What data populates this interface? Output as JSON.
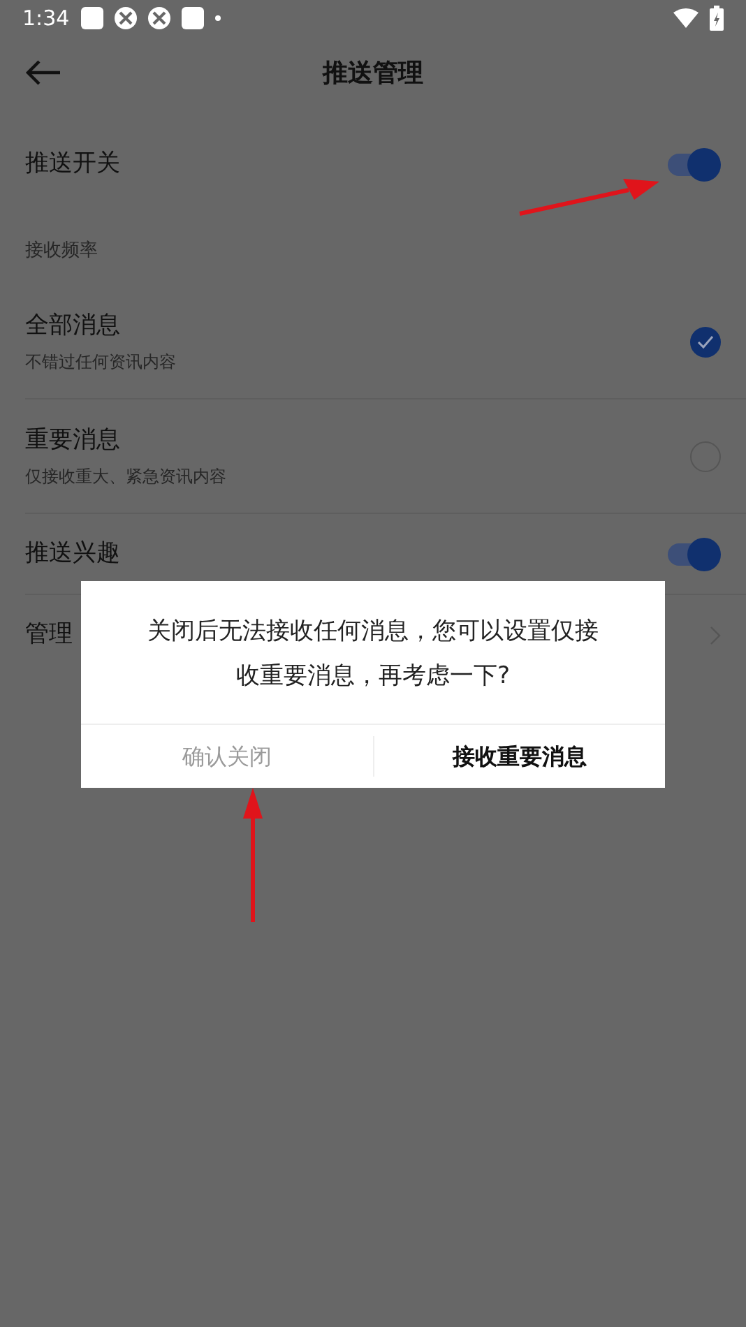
{
  "status_bar": {
    "time": "1:34"
  },
  "header": {
    "title": "推送管理"
  },
  "push_switch": {
    "label": "推送开关",
    "on": true
  },
  "section": {
    "label": "接收频率"
  },
  "frequency_options": [
    {
      "title": "全部消息",
      "subtitle": "不错过任何资讯内容",
      "selected": true
    },
    {
      "title": "重要消息",
      "subtitle": "仅接收重大、紧急资讯内容",
      "selected": false
    }
  ],
  "interest_switch": {
    "label": "推送兴趣",
    "on": true
  },
  "manage_row": {
    "label": "管理"
  },
  "dialog": {
    "message": "关闭后无法接收任何消息，您可以设置仅接收重要消息，再考虑一下?",
    "buttons": [
      {
        "label": "确认关闭",
        "kind": "cancel"
      },
      {
        "label": "接收重要消息",
        "kind": "primary"
      }
    ]
  }
}
